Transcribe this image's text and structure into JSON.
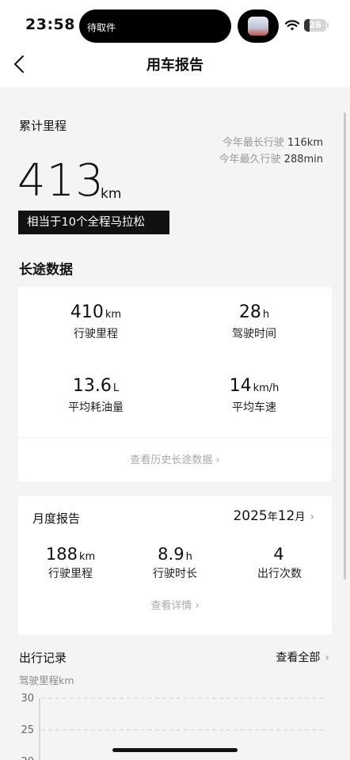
{
  "status_bar": {
    "time": "23:58",
    "island_text": "待取件",
    "battery": "26",
    "battery_level": 0.26
  },
  "nav": {
    "title": "用车报告"
  },
  "mileage": {
    "label": "累计里程",
    "value": "413",
    "unit": "km",
    "longest_trip_label": "今年最长行驶",
    "longest_trip_value": "116km",
    "longest_time_label": "今年最久行驶",
    "longest_time_value": "288min",
    "badge": "相当于10个全程马拉松"
  },
  "long_distance": {
    "title": "长途数据",
    "stats": [
      {
        "value": "410",
        "unit": "km",
        "label": "行驶里程"
      },
      {
        "value": "28",
        "unit": "h",
        "label": "驾驶时间"
      },
      {
        "value": "13.6",
        "unit": "L",
        "label": "平均耗油量"
      },
      {
        "value": "14",
        "unit": "km/h",
        "label": "平均车速"
      }
    ],
    "history_link": "查看历史长途数据 ›"
  },
  "monthly": {
    "title": "月度报告",
    "year": "2025",
    "year_unit": "年",
    "month": "12",
    "month_unit": "月",
    "stats": [
      {
        "value": "188",
        "unit": "km",
        "label": "行驶里程"
      },
      {
        "value": "8.9",
        "unit": "h",
        "label": "行驶时长"
      },
      {
        "value": "4",
        "unit": "",
        "label": "出行次数"
      }
    ],
    "details_link": "查看详情 ›"
  },
  "trips": {
    "title": "出行记录",
    "view_all": "查看全部",
    "chart_label": "驾驶里程km"
  },
  "chart_data": {
    "type": "bar",
    "ylabel": "驾驶里程km",
    "y_ticks": [
      "30",
      "25",
      "20"
    ],
    "ylim": [
      20,
      30
    ],
    "grid": true
  }
}
